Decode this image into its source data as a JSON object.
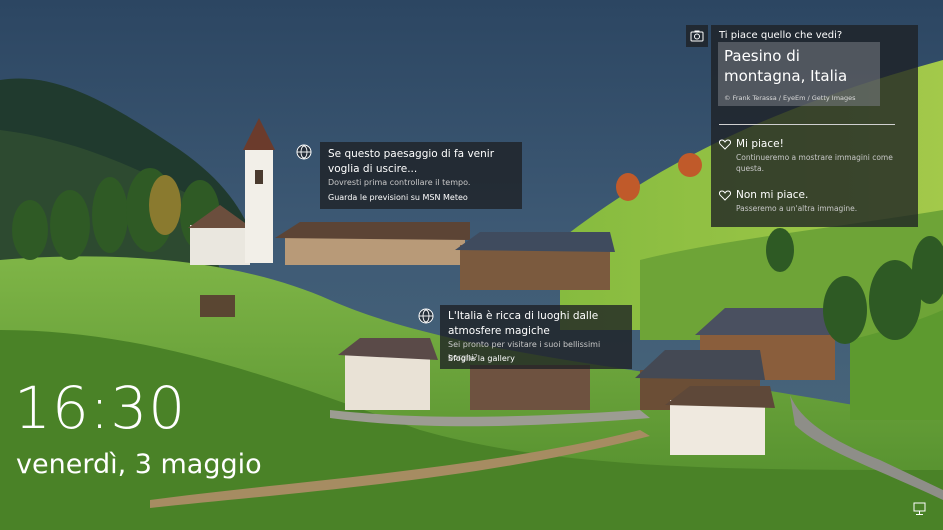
{
  "lockscreen": {
    "time": "16:30",
    "date": "venerdì, 3 maggio"
  },
  "spotlight": {
    "header": "Ti piace quello che vedi?",
    "title": "Paesino di montagna, Italia",
    "credit": "© Frank Terassa / EyeEm / Getty Images",
    "like_label": "Mi piace!",
    "like_desc": "Continueremo a mostrare immagini come questa.",
    "dislike_label": "Non mi piace.",
    "dislike_desc": "Passeremo a un'altra immagine."
  },
  "hotspots": [
    {
      "title": "Se questo paesaggio di fa venir voglia di uscire...",
      "subtitle": "Dovresti prima controllare il tempo.",
      "link": "Guarda le previsioni su MSN Meteo"
    },
    {
      "title": "L'Italia è ricca di luoghi dalle atmosfere magiche",
      "subtitle": "Sei pronto per visitare i suoi bellissimi borghi?",
      "link": "Sfoglia la gallery"
    }
  ],
  "icons": {
    "camera": "camera-icon",
    "globe": "globe-icon",
    "heart": "heart-icon",
    "network": "network-icon"
  },
  "colors": {
    "sky_top": "#2c4662",
    "grass": "#6fa83a",
    "panel": "#1e2024"
  }
}
